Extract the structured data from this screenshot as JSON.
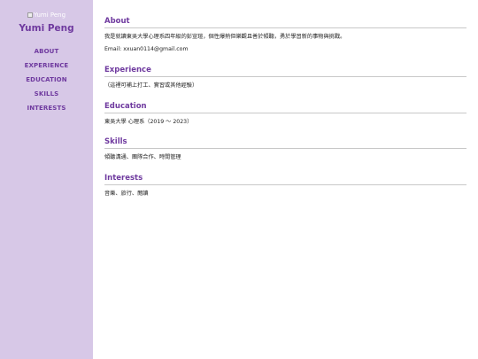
{
  "sidebar": {
    "avatar_alt": "Yumi Peng",
    "name": "Yumi Peng",
    "nav": [
      "ABOUT",
      "EXPERIENCE",
      "EDUCATION",
      "SKILLS",
      "INTERESTS"
    ]
  },
  "sections": {
    "about": {
      "heading": "About",
      "text": "我是就讀東吳大學心理系四年級的彭宣瑄，個性爆熱但樂觀且善於傾聽，勇於學習新的事物與挑戰。",
      "email": "Email: xxuan0114@gmail.com"
    },
    "experience": {
      "heading": "Experience",
      "text": "（這裡可補上打工、實習或其他經驗）"
    },
    "education": {
      "heading": "Education",
      "text": "東吳大學 心理系（2019 ～ 2023）"
    },
    "skills": {
      "heading": "Skills",
      "text": "傾聽溝通、團隊合作、時間管理"
    },
    "interests": {
      "heading": "Interests",
      "text": "音樂、旅行、閱讀"
    }
  },
  "colors": {
    "sidebar_bg": "#d7c8e7",
    "accent": "#6f3a9f"
  },
  "icons": {
    "avatar": "broken-image-icon"
  }
}
